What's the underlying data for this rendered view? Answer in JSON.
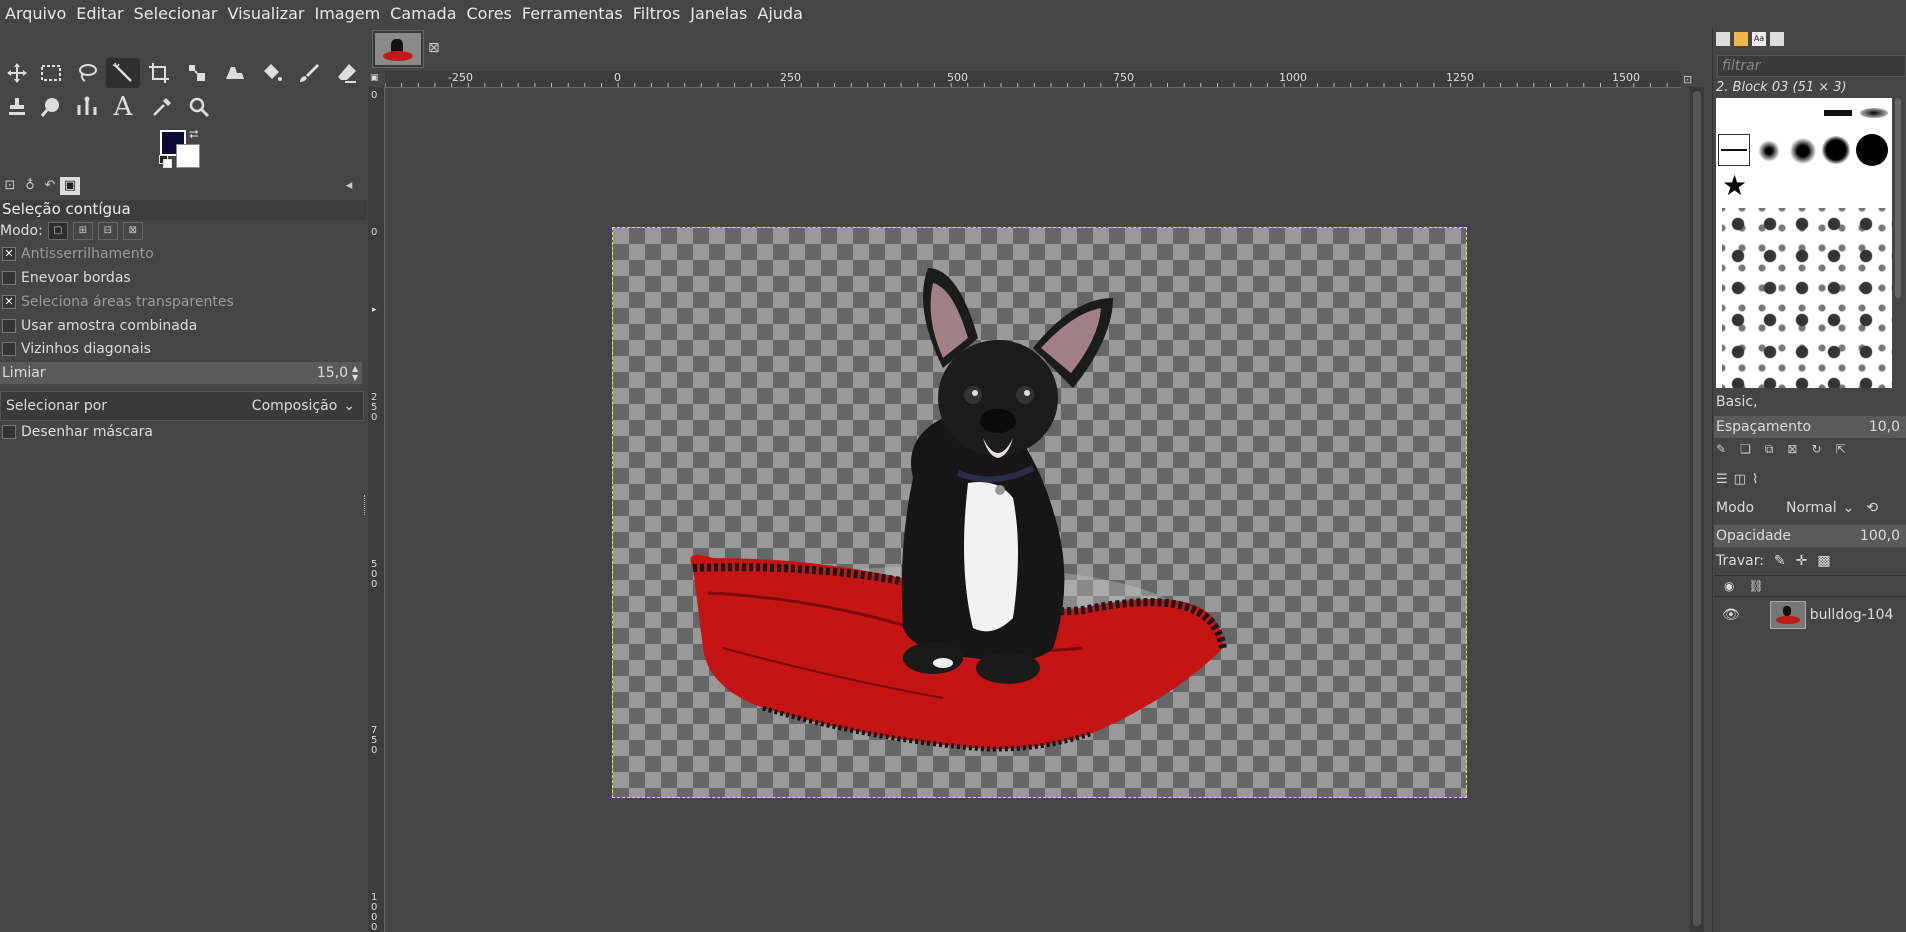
{
  "menubar": [
    "Arquivo",
    "Editar",
    "Selecionar",
    "Visualizar",
    "Imagem",
    "Camada",
    "Cores",
    "Ferramentas",
    "Filtros",
    "Janelas",
    "Ajuda"
  ],
  "tool_options": {
    "title": "Seleção contígua",
    "mode_label": "Modo:",
    "checkboxes": [
      {
        "label": "Antisserrilhamento",
        "checked": true,
        "dim": true
      },
      {
        "label": "Enevoar bordas",
        "checked": false,
        "dim": false
      },
      {
        "label": "Seleciona áreas transparentes",
        "checked": true,
        "dim": true
      },
      {
        "label": "Usar amostra combinada",
        "checked": false,
        "dim": false
      },
      {
        "label": "Vizinhos diagonais",
        "checked": false,
        "dim": false
      }
    ],
    "threshold_label": "Limiar",
    "threshold_value": "15,0",
    "select_by_label": "Selecionar por",
    "select_by_value": "Composição",
    "draw_mask_label": "Desenhar máscara"
  },
  "colors": {
    "foreground": "#0e0a38",
    "background": "#ffffff",
    "selection": "#e6e64a"
  },
  "ruler": {
    "h_labels": [
      "-250",
      "0",
      "250",
      "500",
      "750",
      "1000",
      "1250",
      "1500"
    ],
    "v_labels": [
      "0",
      "0",
      "2 5 0",
      "5 0 0",
      "7 5 0",
      "1 0 0 0"
    ]
  },
  "brushes": {
    "filter_placeholder": "filtrar",
    "selected": "2. Block 03 (51 × 3)",
    "tag": "Basic,",
    "spacing_label": "Espaçamento",
    "spacing_value": "10,0"
  },
  "layers": {
    "mode_label": "Modo",
    "mode_value": "Normal",
    "opacity_label": "Opacidade",
    "opacity_value": "100,0",
    "lock_label": "Travar:",
    "layer_name": "bulldog-104"
  }
}
